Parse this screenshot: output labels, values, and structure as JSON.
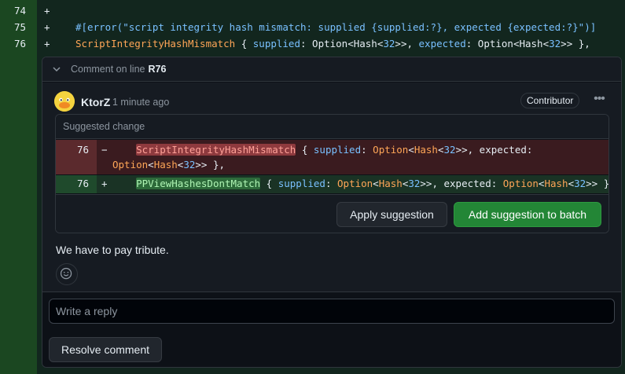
{
  "diff": {
    "lines": [
      {
        "num": "74",
        "sign": "+",
        "tokens": []
      },
      {
        "num": "75",
        "sign": "+",
        "tokens": [
          {
            "t": "#[error(\"script integrity hash mismatch: supplied {supplied:?}, expected {expected:?}\")]",
            "c": "kw"
          }
        ]
      },
      {
        "num": "76",
        "sign": "+",
        "tokens": [
          {
            "t": "ScriptIntegrityHashMismatch",
            "c": "orn"
          },
          {
            "t": " { ",
            "c": "plain"
          },
          {
            "t": "supplied",
            "c": "kw"
          },
          {
            "t": ": Option<Hash<",
            "c": "plain"
          },
          {
            "t": "32",
            "c": "kw"
          },
          {
            "t": ">>, ",
            "c": "plain"
          },
          {
            "t": "expected",
            "c": "kw"
          },
          {
            "t": ": Option<Hash<",
            "c": "plain"
          },
          {
            "t": "32",
            "c": "kw"
          },
          {
            "t": ">> },",
            "c": "plain"
          }
        ]
      }
    ]
  },
  "thread": {
    "header_prefix": "Comment on line",
    "header_line": "R76",
    "author": "KtorZ",
    "time": "1 minute ago",
    "badge": "Contributor",
    "more_label": "•••",
    "suggestion": {
      "title": "Suggested change",
      "deleted": {
        "num": "76",
        "sign": "−",
        "line1": [
          {
            "t": "    ",
            "c": "plain"
          },
          {
            "t": "ScriptIntegrityHashMismatch",
            "c": "hl-del"
          },
          {
            "t": " { ",
            "c": "plain"
          },
          {
            "t": "supplied",
            "c": "kw"
          },
          {
            "t": ": ",
            "c": "plain"
          },
          {
            "t": "Option",
            "c": "orn"
          },
          {
            "t": "<",
            "c": "plain"
          },
          {
            "t": "Hash",
            "c": "orn"
          },
          {
            "t": "<",
            "c": "plain"
          },
          {
            "t": "32",
            "c": "kw"
          },
          {
            "t": ">>, expected:",
            "c": "plain"
          }
        ],
        "line2": [
          {
            "t": "Option",
            "c": "orn"
          },
          {
            "t": "<",
            "c": "plain"
          },
          {
            "t": "Hash",
            "c": "orn"
          },
          {
            "t": "<",
            "c": "plain"
          },
          {
            "t": "32",
            "c": "kw"
          },
          {
            "t": ">> },",
            "c": "plain"
          }
        ]
      },
      "added": {
        "num": "76",
        "sign": "+",
        "line1": [
          {
            "t": "    ",
            "c": "plain"
          },
          {
            "t": "PPViewHashesDontMatch",
            "c": "hl-add"
          },
          {
            "t": " { ",
            "c": "plain"
          },
          {
            "t": "supplied",
            "c": "kw"
          },
          {
            "t": ": ",
            "c": "plain"
          },
          {
            "t": "Option",
            "c": "orn"
          },
          {
            "t": "<",
            "c": "plain"
          },
          {
            "t": "Hash",
            "c": "orn"
          },
          {
            "t": "<",
            "c": "plain"
          },
          {
            "t": "32",
            "c": "kw"
          },
          {
            "t": ">>, expected: ",
            "c": "plain"
          },
          {
            "t": "Option",
            "c": "orn"
          },
          {
            "t": "<",
            "c": "plain"
          },
          {
            "t": "Hash",
            "c": "orn"
          },
          {
            "t": "<",
            "c": "plain"
          },
          {
            "t": "32",
            "c": "kw"
          },
          {
            "t": ">> },",
            "c": "plain"
          }
        ]
      },
      "apply_label": "Apply suggestion",
      "batch_label": "Add suggestion to batch"
    },
    "body": "We have to pay tribute.",
    "reply_placeholder": "Write a reply",
    "resolve_label": "Resolve comment"
  }
}
